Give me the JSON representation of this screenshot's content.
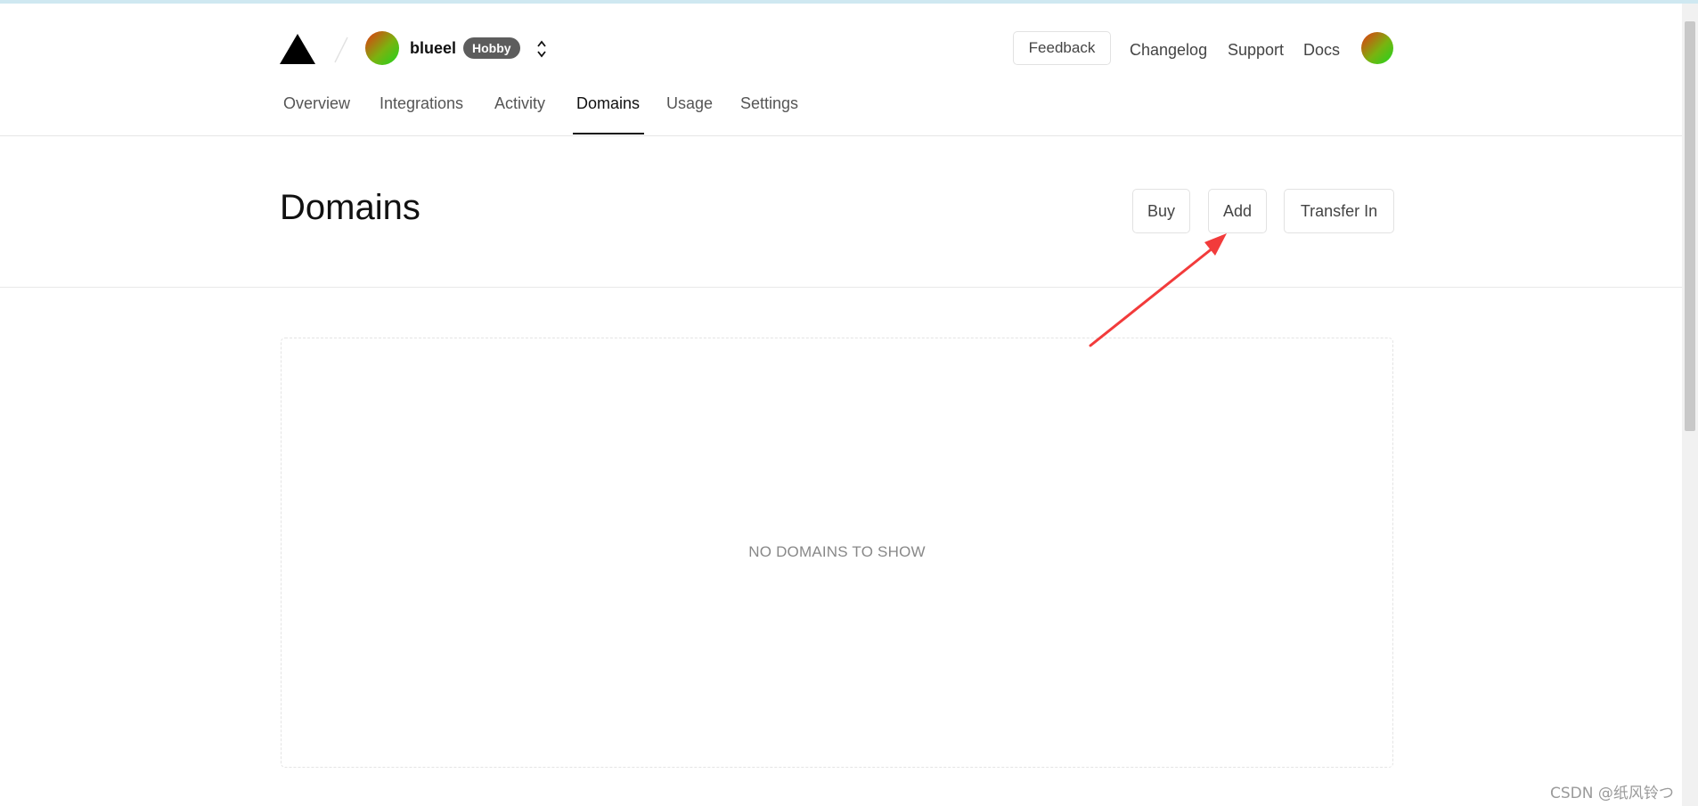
{
  "header": {
    "team_name": "blueel",
    "plan_badge": "Hobby",
    "feedback_label": "Feedback",
    "links": [
      "Changelog",
      "Support",
      "Docs"
    ]
  },
  "tabs": [
    {
      "label": "Overview",
      "active": false
    },
    {
      "label": "Integrations",
      "active": false
    },
    {
      "label": "Activity",
      "active": false
    },
    {
      "label": "Domains",
      "active": true
    },
    {
      "label": "Usage",
      "active": false
    },
    {
      "label": "Settings",
      "active": false
    }
  ],
  "page": {
    "title": "Domains",
    "actions": {
      "buy": "Buy",
      "add": "Add",
      "transfer_in": "Transfer In"
    },
    "empty_message": "NO DOMAINS TO SHOW"
  },
  "annotation": {
    "arrow_color": "#f23b3b",
    "points_to": "add-button"
  },
  "watermark": "CSDN @纸风铃つ",
  "colors": {
    "avatar_gradient": [
      "#e53512",
      "#7ab310",
      "#1fd51f"
    ],
    "badge_bg": "#5d5d5d",
    "top_strip": "#cfe8f1"
  },
  "icons": {
    "logo": "triangle-logo-icon",
    "switcher": "chevron-up-down-icon"
  }
}
